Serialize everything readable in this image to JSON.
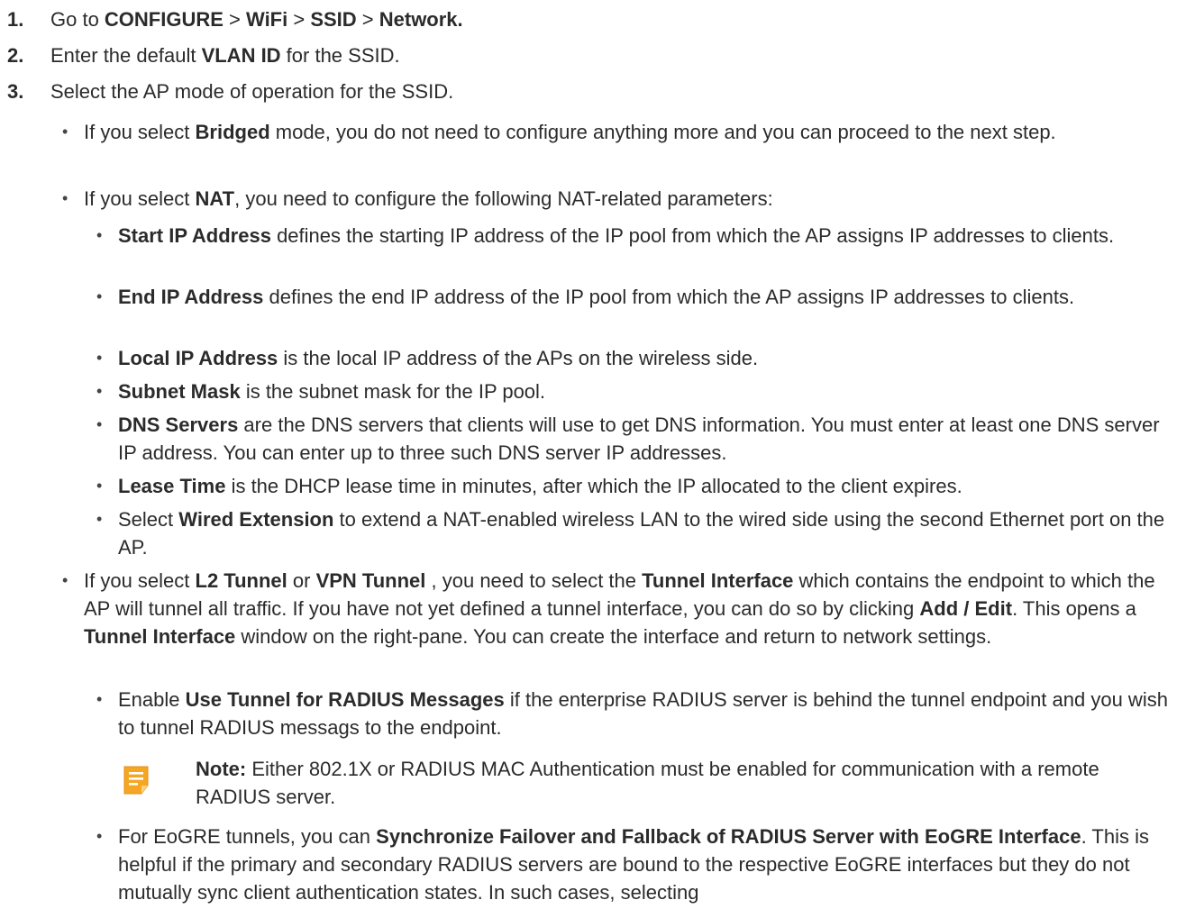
{
  "steps": [
    {
      "num": "1.",
      "parts": [
        {
          "t": "Go to ",
          "b": false
        },
        {
          "t": "CONFIGURE",
          "b": true
        },
        {
          "t": " > ",
          "b": false
        },
        {
          "t": "WiFi",
          "b": true
        },
        {
          "t": " > ",
          "b": false
        },
        {
          "t": "SSID",
          "b": true
        },
        {
          "t": " > ",
          "b": false
        },
        {
          "t": "Network.",
          "b": true
        }
      ]
    },
    {
      "num": "2.",
      "parts": [
        {
          "t": "Enter the default ",
          "b": false
        },
        {
          "t": "VLAN ID",
          "b": true
        },
        {
          "t": " for the SSID.",
          "b": false
        }
      ]
    },
    {
      "num": "3.",
      "parts": [
        {
          "t": "Select the AP mode of operation for the SSID.",
          "b": false
        }
      ]
    }
  ],
  "bullets_l1": [
    {
      "parts": [
        {
          "t": "If you select ",
          "b": false
        },
        {
          "t": "Bridged",
          "b": true
        },
        {
          "t": " mode, you do not need to configure anything more and you can proceed to the next step.",
          "b": false
        }
      ]
    },
    {
      "parts": [
        {
          "t": "If you select ",
          "b": false
        },
        {
          "t": "NAT",
          "b": true
        },
        {
          "t": ", you need to configure the following NAT-related parameters:",
          "b": false
        }
      ]
    },
    {
      "parts": [
        {
          "t": "If you select ",
          "b": false
        },
        {
          "t": "L2 Tunnel",
          "b": true
        },
        {
          "t": " or ",
          "b": false
        },
        {
          "t": "VPN Tunnel",
          "b": true
        },
        {
          "t": " , you need to select the ",
          "b": false
        },
        {
          "t": "Tunnel Interface",
          "b": true
        },
        {
          "t": " which contains the endpoint to which the AP will tunnel all traffic. If you have not yet defined a tunnel interface, you can do so by clicking ",
          "b": false
        },
        {
          "t": "Add / Edit",
          "b": true
        },
        {
          "t": ". This opens a ",
          "b": false
        },
        {
          "t": "Tunnel Interface",
          "b": true
        },
        {
          "t": " window on the right-pane. You can create the interface and return to network settings.",
          "b": false
        }
      ]
    }
  ],
  "nat_params": [
    {
      "parts": [
        {
          "t": "Start IP Address",
          "b": true
        },
        {
          "t": " defines the starting IP address of the IP pool from which the AP assigns IP addresses to clients.",
          "b": false
        }
      ]
    },
    {
      "parts": [
        {
          "t": "End IP Address",
          "b": true
        },
        {
          "t": " defines the end IP address of the IP pool from which the AP assigns IP addresses to clients.",
          "b": false
        }
      ]
    },
    {
      "parts": [
        {
          "t": "Local IP Address",
          "b": true
        },
        {
          "t": " is the local IP address of the APs on the wireless side.",
          "b": false
        }
      ]
    },
    {
      "parts": [
        {
          "t": "Subnet Mask",
          "b": true
        },
        {
          "t": " is the subnet mask for the IP pool.",
          "b": false
        }
      ]
    },
    {
      "parts": [
        {
          "t": "DNS Servers",
          "b": true
        },
        {
          "t": " are the DNS servers that clients will use to get DNS information. You must enter at least one DNS server IP address. You can enter up to three such DNS server IP addresses.",
          "b": false
        }
      ]
    },
    {
      "parts": [
        {
          "t": "Lease Time",
          "b": true
        },
        {
          "t": " is the DHCP lease time in minutes, after which the IP allocated to the client expires.",
          "b": false
        }
      ]
    },
    {
      "parts": [
        {
          "t": "Select ",
          "b": false
        },
        {
          "t": "Wired Extension",
          "b": true
        },
        {
          "t": " to extend a NAT-enabled wireless LAN to the wired side using the second Ethernet port on the AP.",
          "b": false
        }
      ]
    }
  ],
  "tunnel_params": [
    {
      "parts": [
        {
          "t": "Enable ",
          "b": false
        },
        {
          "t": "Use Tunnel for RADIUS Messages",
          "b": true
        },
        {
          "t": " if the enterprise RADIUS server is behind the tunnel endpoint and you wish to tunnel RADIUS messags to the endpoint.",
          "b": false
        }
      ]
    },
    {
      "parts": [
        {
          "t": "For EoGRE tunnels, you can ",
          "b": false
        },
        {
          "t": "Synchronize Failover and Fallback of RADIUS Server with EoGRE Interface",
          "b": true
        },
        {
          "t": ". This is helpful if the primary and secondary RADIUS servers are bound to the respective EoGRE interfaces but they do not mutually sync client authentication states. In such cases, selecting",
          "b": false
        }
      ]
    }
  ],
  "note": {
    "label": "Note:",
    "text": " Either 802.1X or RADIUS MAC Authentication must be enabled for communication with a remote RADIUS server.",
    "icon": "note-icon",
    "icon_color": "#f5a623"
  },
  "bullet_glyph": "•"
}
